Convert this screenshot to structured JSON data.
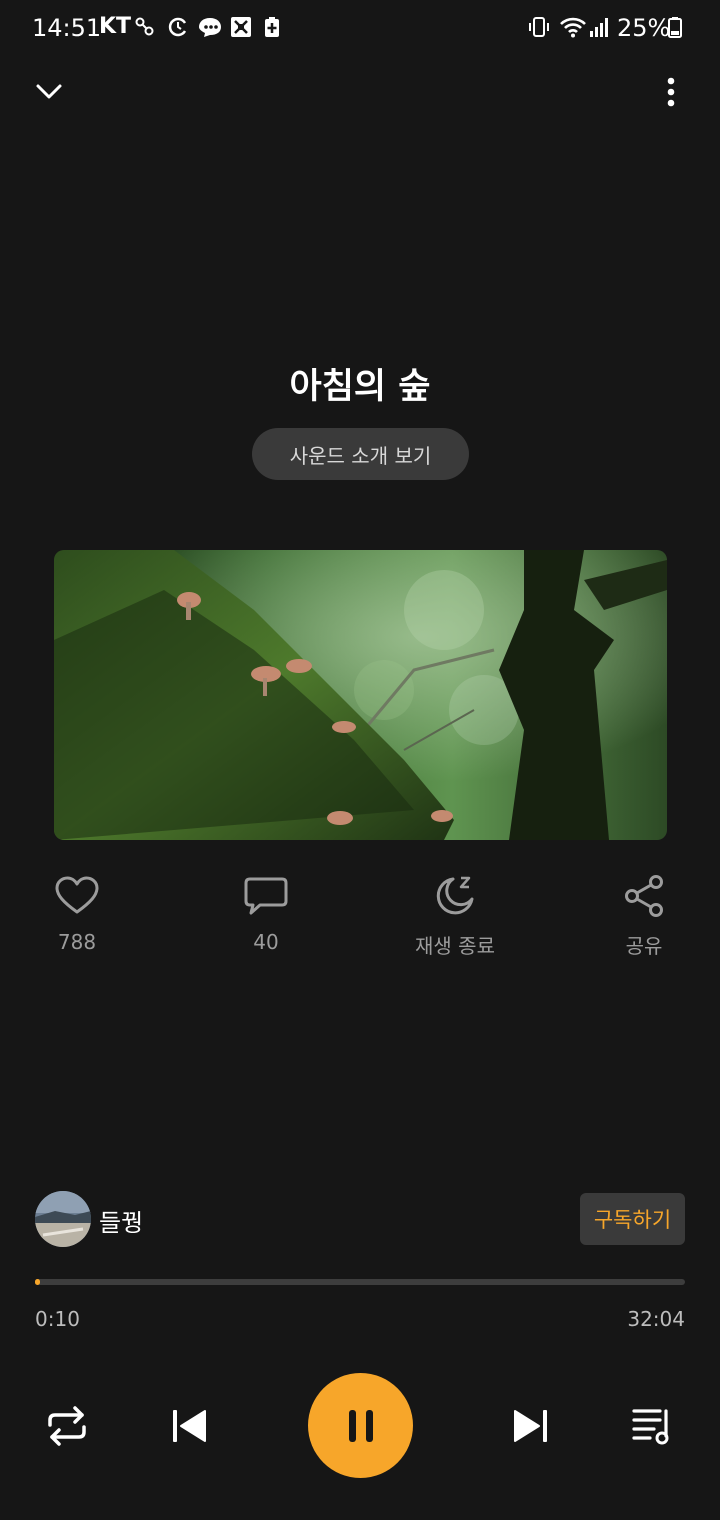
{
  "status_bar": {
    "time": "14:51",
    "carrier": "KT",
    "battery": "25%",
    "icons": [
      "key-icon",
      "alarm-icon",
      "chat-icon",
      "photo-icon",
      "battery-plus-icon",
      "vibrate-icon",
      "wifi-icon",
      "signal-icon",
      "battery-icon"
    ]
  },
  "header": {
    "collapse_icon": "chevron-down-icon",
    "more_icon": "more-vertical-icon"
  },
  "track": {
    "title": "아침의 숲",
    "intro_label": "사운드 소개 보기"
  },
  "actions": {
    "like": {
      "icon": "heart-icon",
      "label": "788"
    },
    "comment": {
      "icon": "comment-icon",
      "label": "40"
    },
    "sleep": {
      "icon": "moon-icon",
      "label": "재생 종료"
    },
    "share": {
      "icon": "share-icon",
      "label": "공유"
    }
  },
  "creator": {
    "name": "들꿩",
    "subscribe_label": "구독하기"
  },
  "player": {
    "elapsed": "0:10",
    "total": "32:04",
    "progress_fraction": 0.005,
    "controls": [
      "repeat-icon",
      "skip-previous-icon",
      "pause-icon",
      "skip-next-icon",
      "playlist-icon"
    ]
  },
  "colors": {
    "background": "#161616",
    "accent": "#f7a62a",
    "pill": "#3a3a3a",
    "muted_text": "#9c9c9c"
  }
}
